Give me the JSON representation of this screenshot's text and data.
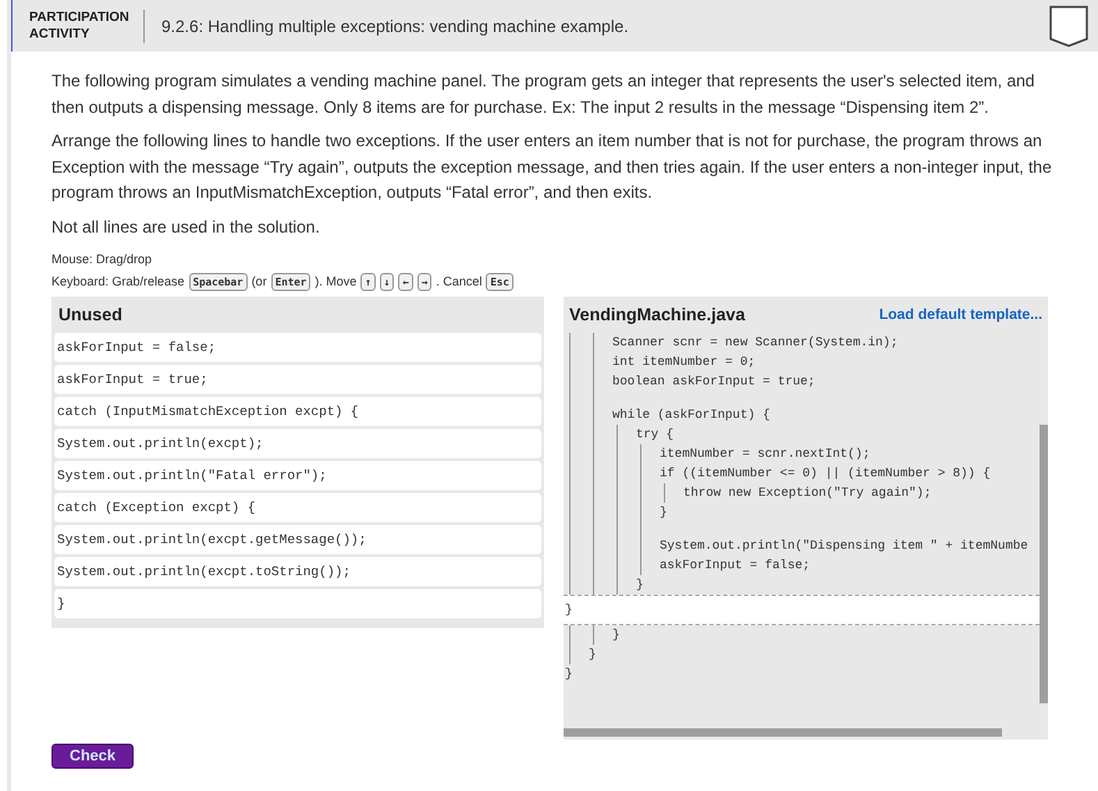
{
  "activity": {
    "badge": "PARTICIPATION ACTIVITY",
    "title": "9.2.6: Handling multiple exceptions: vending machine example.",
    "completed": false
  },
  "instructions": [
    "The following program simulates a vending machine panel. The program gets an integer that represents the user's selected item, and then outputs a dispensing message. Only 8 items are for purchase. Ex: The input 2 results in the message “Dispensing item 2”.",
    "Arrange the following lines to handle two exceptions. If the user enters an item number that is not for purchase, the program throws an Exception with the message “Try again”, outputs the exception message, and then tries again. If the user enters a non-integer input, the program throws an InputMismatchException, outputs “Fatal error”, and then exits.",
    "Not all lines are used in the solution."
  ],
  "controls_help": {
    "mouse": "Mouse: Drag/drop",
    "keyboard": [
      {
        "kind": "text",
        "text": "Keyboard: Grab/release"
      },
      {
        "kind": "key",
        "text": "Spacebar"
      },
      {
        "kind": "text",
        "text": "(or"
      },
      {
        "kind": "key",
        "text": "Enter"
      },
      {
        "kind": "text",
        "text": "). Move"
      },
      {
        "kind": "key",
        "text": "↑"
      },
      {
        "kind": "key",
        "text": "↓"
      },
      {
        "kind": "key",
        "text": "←"
      },
      {
        "kind": "key",
        "text": "→"
      },
      {
        "kind": "text",
        "text": ". Cancel"
      },
      {
        "kind": "key",
        "text": "Esc"
      }
    ]
  },
  "unused": {
    "title": "Unused",
    "lines": [
      "askForInput = false;",
      "askForInput = true;",
      "catch (InputMismatchException excpt) {",
      "System.out.println(excpt);",
      "System.out.println(\"Fatal error\");",
      "catch (Exception excpt) {",
      "System.out.println(excpt.getMessage());",
      "System.out.println(excpt.toString());",
      "}"
    ]
  },
  "editor": {
    "filename": "VendingMachine.java",
    "link": "Load default template...",
    "code": [
      {
        "kind": "group",
        "children": [
          {
            "kind": "group",
            "children": [
              {
                "kind": "line",
                "text": "Scanner scnr = new Scanner(System.in);"
              },
              {
                "kind": "line",
                "text": "int itemNumber = 0;"
              },
              {
                "kind": "line",
                "text": "boolean askForInput = true;"
              },
              {
                "kind": "blank"
              },
              {
                "kind": "line",
                "text": "while (askForInput) {",
                "children": [
                  {
                    "kind": "line",
                    "text": "try {",
                    "children": [
                      {
                        "kind": "line",
                        "text": "itemNumber = scnr.nextInt();"
                      },
                      {
                        "kind": "line",
                        "text": "if ((itemNumber <= 0) || (itemNumber > 8)) {",
                        "children": [
                          {
                            "kind": "line",
                            "text": "throw new Exception(\"Try again\");"
                          }
                        ]
                      },
                      {
                        "kind": "line",
                        "text": "}"
                      },
                      {
                        "kind": "blank"
                      },
                      {
                        "kind": "line",
                        "text": "System.out.println(\"Dispensing item \" + itemNumbe"
                      },
                      {
                        "kind": "line",
                        "text": "askForInput = false;"
                      }
                    ]
                  },
                  {
                    "kind": "line",
                    "text": "}"
                  }
                ]
              }
            ]
          }
        ]
      },
      {
        "kind": "slot",
        "text": "}"
      },
      {
        "kind": "group",
        "children": [
          {
            "kind": "group",
            "children": [
              {
                "kind": "line",
                "text": "}"
              }
            ]
          },
          {
            "kind": "line",
            "text": "}"
          }
        ]
      },
      {
        "kind": "line",
        "text": "}"
      }
    ]
  },
  "check_button": "Check"
}
